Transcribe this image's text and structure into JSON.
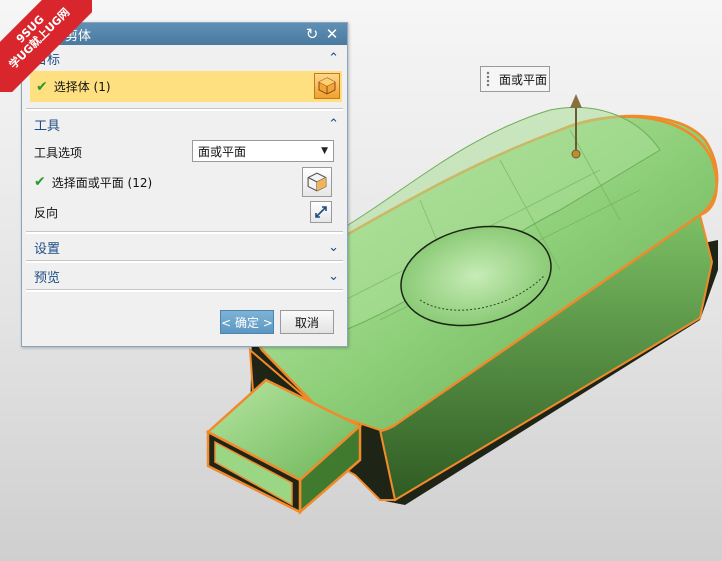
{
  "watermark": {
    "line1": "9SUG",
    "line2": "学UG就上UG网"
  },
  "dialog": {
    "title": "修剪体",
    "target_section": {
      "label": "目标",
      "select_body_label": "选择体 (1)"
    },
    "tool_section": {
      "label": "工具",
      "tool_option_label": "工具选项",
      "tool_option_value": "面或平面",
      "select_face_label": "选择面或平面 (12)",
      "reverse_label": "反向"
    },
    "settings_label": "设置",
    "preview_label": "预览",
    "ok_label": "< 确定 >",
    "cancel_label": "取消"
  },
  "viewport": {
    "callout_label": "面或平面",
    "body_color": "#8fd07a",
    "edge_color": "#f08a2a",
    "dark_color": "#1e2416"
  }
}
